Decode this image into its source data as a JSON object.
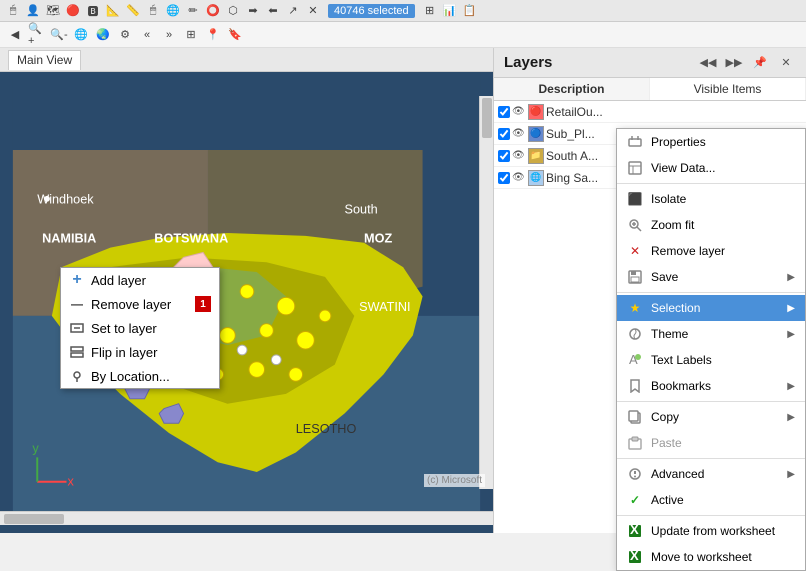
{
  "toolbar": {
    "badge_label": "40746 selected"
  },
  "map_tab": {
    "label": "Main View"
  },
  "layers_panel": {
    "title": "Layers",
    "tab_description": "Description",
    "tab_visible": "Visible Items",
    "layers": [
      {
        "name": "RetailOu...",
        "checked": true,
        "visible": true,
        "icon": "🔴"
      },
      {
        "name": "Sub_Pl...",
        "checked": true,
        "visible": true,
        "icon": "🔵"
      },
      {
        "name": "South A...",
        "checked": true,
        "visible": true,
        "icon": "📁"
      },
      {
        "name": "Bing Sa...",
        "checked": true,
        "visible": true,
        "icon": "🌐"
      }
    ]
  },
  "layer_context_menu": {
    "items": [
      {
        "label": "Add layer",
        "icon": "+"
      },
      {
        "label": "Remove layer",
        "icon": "—"
      },
      {
        "label": "Set to layer",
        "icon": "↓"
      },
      {
        "label": "Flip in layer",
        "icon": "⇅"
      },
      {
        "label": "By Location...",
        "icon": "📍"
      }
    ]
  },
  "right_context_menu": {
    "items": [
      {
        "label": "Properties",
        "icon": "⚙",
        "arrow": false
      },
      {
        "label": "View Data...",
        "icon": "📊",
        "arrow": false
      },
      {
        "label": "Isolate",
        "icon": "◈",
        "arrow": false
      },
      {
        "label": "Zoom fit",
        "icon": "🔍",
        "arrow": false
      },
      {
        "label": "Remove layer",
        "icon": "✕",
        "arrow": false
      },
      {
        "label": "Save",
        "icon": "💾",
        "arrow": true
      },
      {
        "label": "Selection",
        "icon": "★",
        "arrow": true,
        "highlighted": true
      },
      {
        "label": "Theme",
        "icon": "🎨",
        "arrow": true
      },
      {
        "label": "Text Labels",
        "icon": "🏷",
        "arrow": false
      },
      {
        "label": "Bookmarks",
        "icon": "🔖",
        "arrow": true
      },
      {
        "label": "Copy",
        "icon": "📋",
        "arrow": true
      },
      {
        "label": "Paste",
        "icon": "📄",
        "arrow": false
      },
      {
        "label": "Advanced",
        "icon": "⚡",
        "arrow": true
      },
      {
        "label": "Active",
        "icon": "✓",
        "arrow": false
      },
      {
        "label": "Update from worksheet",
        "icon": "📗",
        "arrow": false
      },
      {
        "label": "Move to worksheet",
        "icon": "📗",
        "arrow": false
      }
    ]
  },
  "map_copyright": "(c) Microsoft",
  "remove_layer_badge": "1"
}
